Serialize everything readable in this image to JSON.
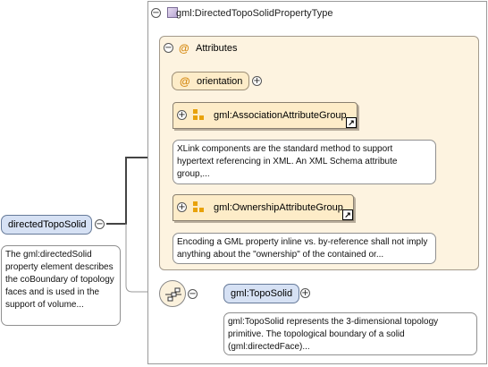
{
  "type_title": "gml:DirectedTopoSolidPropertyType",
  "attributes_label": "Attributes",
  "orientation_label": "orientation",
  "association_group_label": "gml:AssociationAttributeGroup",
  "association_doc": "XLink components are the standard method to support hypertext referencing in XML. An XML Schema attribute group,...",
  "ownership_group_label": "gml:OwnershipAttributeGroup",
  "ownership_doc": "Encoding a GML property inline vs. by-reference shall not imply anything about the \"ownership\" of the contained or...",
  "element_label": "directedTopoSolid",
  "element_doc": "The gml:directedSolid property element describes the coBoundary of topology faces and is used in the support of volume...",
  "topo_label": "gml:TopoSolid",
  "topo_doc": "gml:TopoSolid represents the 3-dimensional topology primitive. The topological boundary of a solid (gml:directedFace)...",
  "symbols": {
    "at": "@",
    "minus": "−",
    "plus": "+",
    "link": "↗"
  },
  "colors": {
    "attr_fill": "#fdf3e0",
    "group_fill": "#fdecc8",
    "element_fill": "#d6e1f4",
    "group_icon": "#e8a20a"
  }
}
